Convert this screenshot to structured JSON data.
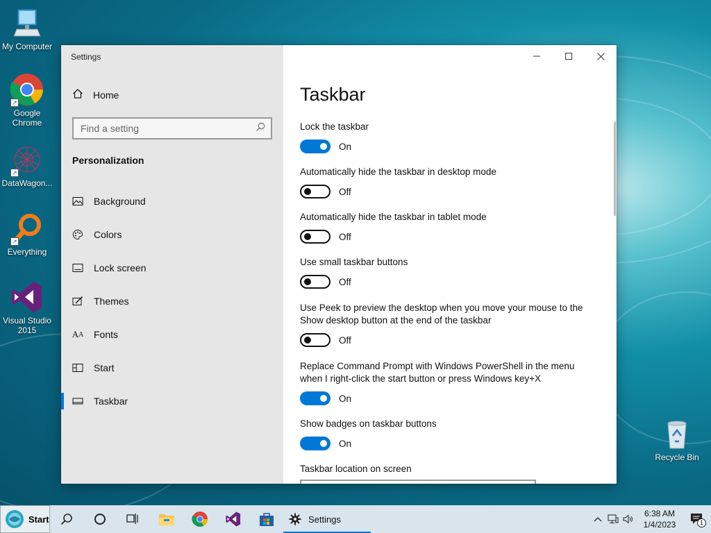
{
  "desktop": {
    "icons": [
      {
        "label": "My Computer"
      },
      {
        "label": "Google Chrome"
      },
      {
        "label": "DataWagon..."
      },
      {
        "label": "Everything"
      },
      {
        "label": "Visual Studio 2015"
      },
      {
        "label": "Recycle Bin"
      }
    ]
  },
  "window": {
    "title": "Settings",
    "sidebar": {
      "home_label": "Home",
      "search_placeholder": "Find a setting",
      "section_heading": "Personalization",
      "items": [
        {
          "label": "Background",
          "icon": "picture-icon"
        },
        {
          "label": "Colors",
          "icon": "palette-icon"
        },
        {
          "label": "Lock screen",
          "icon": "lock-screen-icon"
        },
        {
          "label": "Themes",
          "icon": "themes-icon"
        },
        {
          "label": "Fonts",
          "icon": "fonts-icon"
        },
        {
          "label": "Start",
          "icon": "start-icon"
        },
        {
          "label": "Taskbar",
          "icon": "taskbar-icon",
          "active": true
        }
      ]
    },
    "content": {
      "page_title": "Taskbar",
      "settings": [
        {
          "label": "Lock the taskbar",
          "state": "On"
        },
        {
          "label": "Automatically hide the taskbar in desktop mode",
          "state": "Off"
        },
        {
          "label": "Automatically hide the taskbar in tablet mode",
          "state": "Off"
        },
        {
          "label": "Use small taskbar buttons",
          "state": "Off"
        },
        {
          "label": "Use Peek to preview the desktop when you move your mouse to the Show desktop button at the end of the taskbar",
          "state": "Off"
        },
        {
          "label": "Replace Command Prompt with Windows PowerShell in the menu when I right-click the start button or press Windows key+X",
          "state": "On"
        },
        {
          "label": "Show badges on taskbar buttons",
          "state": "On"
        }
      ],
      "location_label": "Taskbar location on screen"
    }
  },
  "taskbar": {
    "start_label": "Start",
    "active_app_label": "Settings",
    "clock_time": "6:38 AM",
    "clock_date": "1/4/2023",
    "notification_count": "1"
  },
  "colors": {
    "accent": "#0078d7",
    "sidebar_bg": "#e6e6e6",
    "taskbar_bg": "#d9e4ec"
  }
}
